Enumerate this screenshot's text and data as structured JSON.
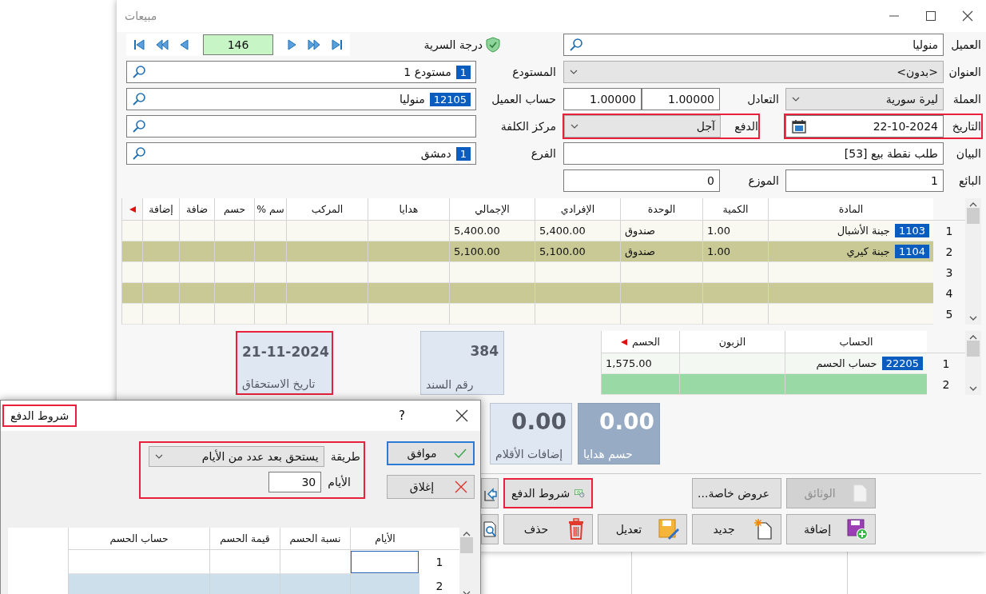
{
  "main_window": {
    "title": "مبيعات"
  },
  "navigator": {
    "record": "146",
    "security_label": "درجة السرية"
  },
  "form": {
    "customer": {
      "label": "العميل",
      "value": "منوليا"
    },
    "address": {
      "label": "العنوان",
      "value": "<بدون>"
    },
    "currency": {
      "label": "العملة",
      "value": "ليرة سورية"
    },
    "exchange": {
      "label": "التعادل",
      "values": [
        "1.00000",
        "1.00000"
      ]
    },
    "date": {
      "label": "التاريخ",
      "value": "22-10-2024",
      "highlight": true
    },
    "payment": {
      "label": "الدفع",
      "value": "آجل",
      "highlight": true
    },
    "statement": {
      "label": "البيان",
      "value": "طلب نقطة بيع [53]"
    },
    "seller": {
      "label": "البائع",
      "value": "1"
    },
    "distributor": {
      "label": "الموزع",
      "value": "0"
    },
    "warehouse": {
      "label": "المستودع",
      "code": "1",
      "value": "مستودع 1"
    },
    "customer_account": {
      "label": "حساب العميل",
      "code": "12105",
      "value": "منوليا"
    },
    "cost_center": {
      "label": "مركز الكلفة"
    },
    "branch": {
      "label": "الفرع",
      "code": "1",
      "value": "دمشق"
    }
  },
  "items_table": {
    "columns": [
      "المادة",
      "الكمية",
      "الوحدة",
      "الإفرادي",
      "الإجمالي",
      "هدايا",
      "المركب",
      "سم %",
      "حسم",
      "ضافة",
      "إضافة"
    ],
    "rows": [
      {
        "number": "1",
        "code": "1103",
        "item": "جبنة الأشبال",
        "qty": "1.00",
        "unit": "صندوق",
        "price": "5,400.00",
        "total": "5,400.00"
      },
      {
        "number": "2",
        "code": "1104",
        "item": "جبنة كيري",
        "qty": "1.00",
        "unit": "صندوق",
        "price": "5,100.00",
        "total": "5,100.00"
      },
      {
        "number": "3"
      },
      {
        "number": "4"
      },
      {
        "number": "5"
      }
    ]
  },
  "discount_table": {
    "columns": [
      "الحساب",
      "الزبون",
      "الحسم"
    ],
    "rows": [
      {
        "number": "1",
        "code": "22205",
        "account": "حساب الحسم",
        "amount": "1,575.00",
        "selected": false
      },
      {
        "number": "2",
        "selected": true
      }
    ]
  },
  "summary_tiles": [
    {
      "value": "384",
      "label": "رقم السند",
      "highlight": false
    },
    {
      "value": "21-11-2024",
      "label": "تاريخ الاستحقاق",
      "highlight": true
    }
  ],
  "total_tiles": [
    {
      "value": "0.00",
      "label": "حسم هدايا",
      "kind": "dark"
    },
    {
      "value": "0.00",
      "label": "إضافات الأقلام",
      "kind": "light"
    }
  ],
  "button_rows": [
    [
      {
        "label": "الوثائق",
        "disabled": true
      },
      {
        "label": "عروض خاصة...",
        "disabled": false
      },
      {
        "label": "شروط الدفع",
        "disabled": false,
        "highlight": true
      }
    ],
    [
      {
        "label": "إضافة",
        "disabled": false
      },
      {
        "label": "جديد",
        "disabled": false
      },
      {
        "label": "تعديل",
        "disabled": false
      },
      {
        "label": "حذف",
        "disabled": false
      }
    ]
  ],
  "dialog": {
    "title": "شروط الدفع",
    "title_highlight": true,
    "help": "?",
    "ok_button": "موافق",
    "close_button": "إغلاق",
    "terms": {
      "highlight": true,
      "method_label": "طريقة",
      "method": "يستحق بعد عدد من الأيام",
      "days_label": "الأيام",
      "days": "30"
    },
    "table": {
      "columns": [
        "الأيام",
        "نسبة الحسم",
        "قيمة الحسم",
        "حساب الحسم"
      ],
      "rows": [
        {
          "number": "1",
          "focused": true
        },
        {
          "number": "2",
          "focused": false
        }
      ]
    }
  }
}
